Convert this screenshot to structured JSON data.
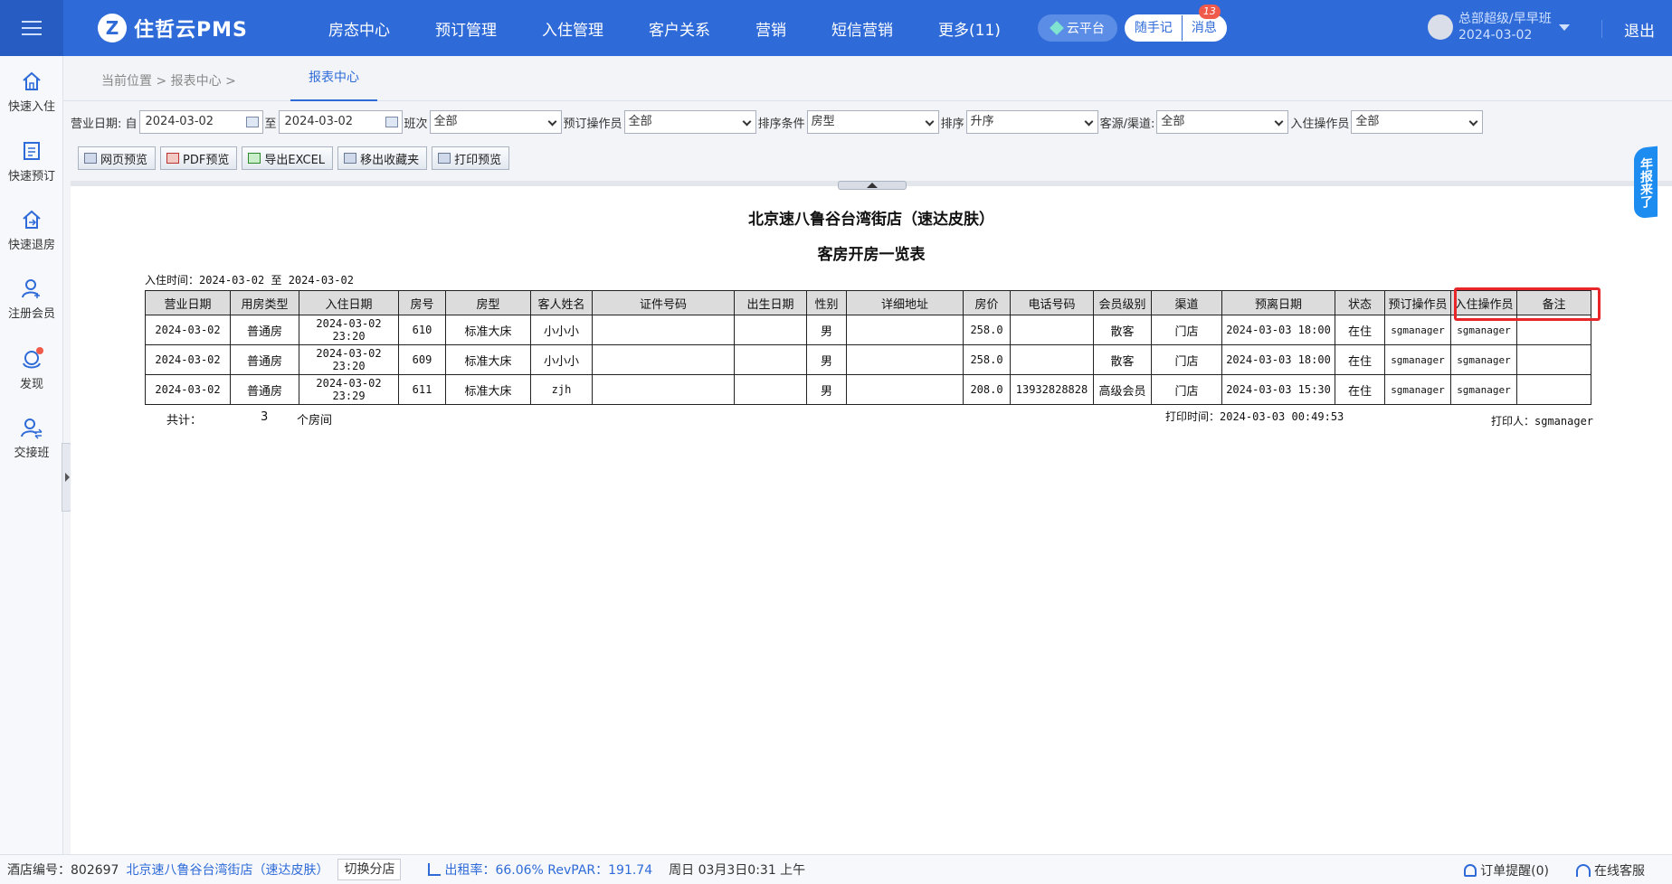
{
  "app": {
    "logo_text": "住哲云PMS",
    "nav": [
      "房态中心",
      "预订管理",
      "入住管理",
      "客户关系",
      "营销",
      "短信营销",
      "更多(11)"
    ],
    "cloud_label": "云平台",
    "notes_label": "随手记",
    "messages_label": "消息",
    "messages_count": "13",
    "user_role": "总部超级/早早班",
    "user_date": "2024-03-02",
    "logout_label": "退出"
  },
  "sidebar": [
    {
      "label": "快速入住",
      "icon": "home-icon"
    },
    {
      "label": "快速预订",
      "icon": "booking-icon"
    },
    {
      "label": "快速退房",
      "icon": "checkout-icon"
    },
    {
      "label": "注册会员",
      "icon": "add-member-icon"
    },
    {
      "label": "发现",
      "icon": "discover-icon"
    },
    {
      "label": "交接班",
      "icon": "shift-handover-icon"
    }
  ],
  "breadcrumb": {
    "current_label": "当前位置",
    "sep": ">",
    "section": "报表中心",
    "tab": "报表中心"
  },
  "filters": {
    "biz_date_label": "营业日期: 自",
    "from_date": "2024-03-02",
    "to_label": "至",
    "to_date": "2024-03-02",
    "shift_label": "班次",
    "shift_value": "全部",
    "booking_op_label": "预订操作员",
    "booking_op_value": "全部",
    "sort_cond_label": "排序条件",
    "sort_cond_value": "房型",
    "sort_label": "排序",
    "sort_value": "升序",
    "channel_label": "客源/渠道:",
    "channel_value": "全部",
    "checkin_op_label": "入住操作员",
    "checkin_op_value": "全部"
  },
  "toolbar": [
    "网页预览",
    "PDF预览",
    "导出EXCEL",
    "移出收藏夹",
    "打印预览"
  ],
  "report": {
    "hotel_name": "北京速八鲁谷台湾街店（速达皮肤）",
    "title": "客房开房一览表",
    "checkin_range": "入住时间：2024-03-02 至 2024-03-02",
    "columns": [
      "营业日期",
      "用房类型",
      "入住日期",
      "房号",
      "房型",
      "客人姓名",
      "证件号码",
      "出生日期",
      "性别",
      "详细地址",
      "房价",
      "电话号码",
      "会员级别",
      "渠道",
      "预离日期",
      "状态",
      "预订操作员",
      "入住操作员",
      "备注"
    ],
    "rows": [
      [
        "2024-03-02",
        "普通房",
        "2024-03-02 23:20",
        "610",
        "标准大床",
        "小小小",
        "",
        "",
        "男",
        "",
        "258.0",
        "",
        "散客",
        "门店",
        "2024-03-03 18:00",
        "在住",
        "sgmanager",
        "sgmanager",
        ""
      ],
      [
        "2024-03-02",
        "普通房",
        "2024-03-02 23:20",
        "609",
        "标准大床",
        "小小小",
        "",
        "",
        "男",
        "",
        "258.0",
        "",
        "散客",
        "门店",
        "2024-03-03 18:00",
        "在住",
        "sgmanager",
        "sgmanager",
        ""
      ],
      [
        "2024-03-02",
        "普通房",
        "2024-03-02 23:29",
        "611",
        "标准大床",
        "zjh",
        "",
        "",
        "男",
        "",
        "208.0",
        "13932828828",
        "高级会员",
        "门店",
        "2024-03-03 15:30",
        "在住",
        "sgmanager",
        "sgmanager",
        ""
      ]
    ],
    "total_label": "共计：",
    "total_count": "3",
    "total_unit": "个房间",
    "print_time": "打印时间：2024-03-03 00:49:53",
    "printed_by": "打印人：sgmanager"
  },
  "float_tag": "年报来了",
  "statusbar": {
    "hotel_code": "酒店编号：802697",
    "hotel_name": "北京速八鲁谷台湾街店（速达皮肤）",
    "switch_label": "切换分店",
    "occupancy": "出租率：66.06% RevPAR：191.74",
    "datetime": "周日 03月3日0:31 上午",
    "order_alert": "订单提醒(0)",
    "support": "在线客服"
  }
}
